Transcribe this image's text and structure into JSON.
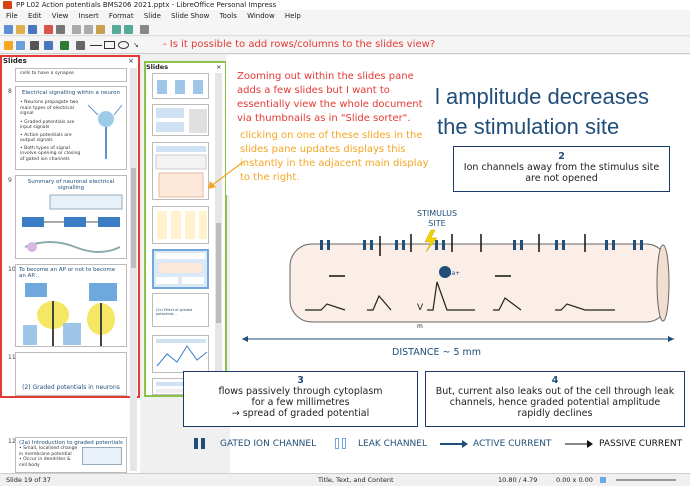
{
  "window": {
    "title": "PP L02 Action potentials BMS206 2021.pptx - LibreOffice Personal Impress"
  },
  "menu": [
    "File",
    "Edit",
    "View",
    "Insert",
    "Format",
    "Slide",
    "Slide Show",
    "Tools",
    "Window",
    "Help"
  ],
  "left_pane": {
    "title": "Slides",
    "close_glyph": "×",
    "slides": [
      {
        "number": "8",
        "title": "Electrical signalling within a neuron",
        "bullets": [
          "Neurons propagate two main types of electrical signal",
          "Graded potentials are input signals",
          "Action potentials are output signals",
          "Both types of signal involve opening or closing of gated ion channels"
        ]
      },
      {
        "number": "9",
        "title": "Summary of neuronal electrical signalling"
      },
      {
        "number": "10",
        "title": "To become an AP or not to become an AP..."
      },
      {
        "number": "11",
        "title": "(2) Graded potentials in neurons"
      },
      {
        "number": "12",
        "title": "(2a) Introduction to graded potentials",
        "bullets": [
          "Small, localised change in membrane potential",
          "Occur in dendrites & cell body"
        ]
      }
    ],
    "top_snippet": "cells to have a synapse"
  },
  "mid_pane": {
    "title": "Slides",
    "close_glyph": "×",
    "slides": [
      "",
      "",
      "17",
      "18",
      "19",
      "20",
      "21",
      "22",
      "23"
    ],
    "slide20_text": "(2c) Effect of graded potentials..."
  },
  "overlay": {
    "question": "- Is it possible to add rows/columns to the slides view?",
    "red_note": "Zooming out within the slides pane adds a few slides but I want to essentially view the whole document via thumbnails as in \"Slide sorter\".",
    "yellow_note": "clicking on one of these slides in the slides pane updates displays this instantly in the adjacent main display to the right."
  },
  "slide": {
    "title_line1": "l amplitude decreases",
    "title_line2": "the stimulation site",
    "box2": {
      "number": "2",
      "text": "Ion channels away from the stimulus site are not opened"
    },
    "stimulus_label": "STIMULUS SITE",
    "na_label": "Na+",
    "v_label": "V",
    "m_label": "m",
    "distance_label": "DISTANCE ~ 5 mm",
    "box3": {
      "number": "3",
      "text_line1": "flows passively through cytoplasm",
      "text_line2": "for a few millimetres",
      "text_line3": "→ spread of graded potential"
    },
    "box4": {
      "number": "4",
      "text": "But, current also leaks out of the cell through leak channels, hence graded potential amplitude rapidly declines"
    },
    "legend": {
      "gated": "GATED ION CHANNEL",
      "leak": "LEAK CHANNEL",
      "active": "ACTIVE CURRENT",
      "passive": "PASSIVE CURRENT"
    }
  },
  "status": {
    "slide_info": "Slide 19 of 37",
    "layout": "Title, Text, and Content",
    "position": "10.80 / 4.79",
    "size": "0.00 x 0.00"
  }
}
